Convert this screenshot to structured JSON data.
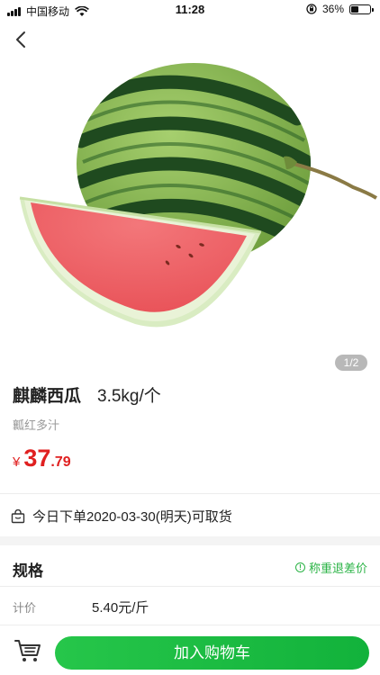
{
  "status_bar": {
    "carrier": "中国移动",
    "time": "11:28",
    "battery_percent_text": "36%",
    "battery_level": 0.36
  },
  "product": {
    "image_page": "1/2",
    "name": "麒麟西瓜",
    "weight": "3.5kg/个",
    "tagline": "瓤红多汁",
    "price_symbol": "¥",
    "price_integer": "37",
    "price_decimal": ".79",
    "pickup_text": "今日下单2020-03-30(明天)可取货"
  },
  "spec": {
    "title": "规格",
    "refund_link": "称重退差价",
    "unit_label": "计价",
    "unit_value": "5.40元/斤"
  },
  "bottom": {
    "add_to_cart": "加入购物车"
  },
  "colors": {
    "accent_green": "#1fbe45",
    "price_red": "#e02020"
  },
  "icons": [
    "back-arrow-icon",
    "wifi-icon",
    "signal-icon",
    "orientation-lock-icon",
    "battery-icon",
    "shop-bag-icon",
    "info-circle-icon",
    "cart-icon"
  ]
}
